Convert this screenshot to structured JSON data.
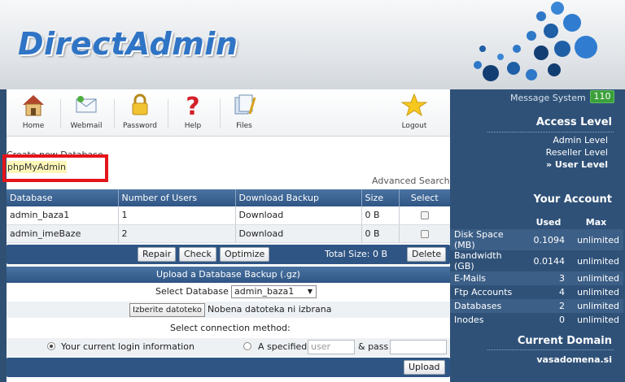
{
  "header": {
    "logo_text": "DirectAdmin"
  },
  "toolbar": {
    "items": [
      {
        "label": "Home",
        "icon": "home-icon"
      },
      {
        "label": "Webmail",
        "icon": "webmail-icon"
      },
      {
        "label": "Password",
        "icon": "lock-icon"
      },
      {
        "label": "Help",
        "icon": "help-icon"
      },
      {
        "label": "Files",
        "icon": "files-icon"
      },
      {
        "label": "Logout",
        "icon": "star-icon"
      }
    ]
  },
  "content": {
    "create_db_link": "Create new Database",
    "phpmyadmin_link": "phpMyAdmin",
    "advanced_search": "Advanced Search"
  },
  "db_table": {
    "headers": [
      "Database",
      "Number of Users",
      "Download Backup",
      "Size",
      "Select"
    ],
    "rows": [
      {
        "name": "admin_baza1",
        "users": "1",
        "download": "Download",
        "size": "0 B"
      },
      {
        "name": "admin_imeBaze",
        "users": "2",
        "download": "Download",
        "size": "0 B"
      }
    ]
  },
  "actions": {
    "repair": "Repair",
    "check": "Check",
    "optimize": "Optimize",
    "total_size": "Total Size: 0 B",
    "delete": "Delete"
  },
  "upload": {
    "title": "Upload a Database Backup (.gz)",
    "select_label": "Select Database",
    "select_value": "admin_baza1",
    "file_button": "Izberite datoteko",
    "file_status": "Nobena datoteka ni izbrana",
    "conn_title": "Select connection method:",
    "radio_current": "Your current login information",
    "radio_specified": "A specified",
    "user_placeholder": "user",
    "pass_label": "& pass",
    "upload_button": "Upload"
  },
  "sidebar": {
    "message_system": "Message System",
    "message_count": "110",
    "access_level_title": "Access Level",
    "levels": [
      "Admin Level",
      "Reseller Level",
      "» User Level"
    ],
    "account_title": "Your Account",
    "account_headers": [
      "Used",
      "Max"
    ],
    "account_rows": [
      {
        "label": "Disk Space (MB)",
        "used": "0.1094",
        "max": "unlimited"
      },
      {
        "label": "Bandwidth (GB)",
        "used": "0.0144",
        "max": "unlimited"
      },
      {
        "label": "E-Mails",
        "used": "3",
        "max": "unlimited"
      },
      {
        "label": "Ftp Accounts",
        "used": "4",
        "max": "unlimited"
      },
      {
        "label": "Databases",
        "used": "2",
        "max": "unlimited"
      },
      {
        "label": "Inodes",
        "used": "0",
        "max": "unlimited"
      }
    ],
    "domain_title": "Current Domain",
    "domain": "vasadomena.si"
  },
  "colors": {
    "brand_blue": "#2f74c5",
    "panel_blue": "#2f5178",
    "header_blue": "#2f5584",
    "highlight_red": "#e4141b",
    "badge_green": "#3aa03a"
  }
}
